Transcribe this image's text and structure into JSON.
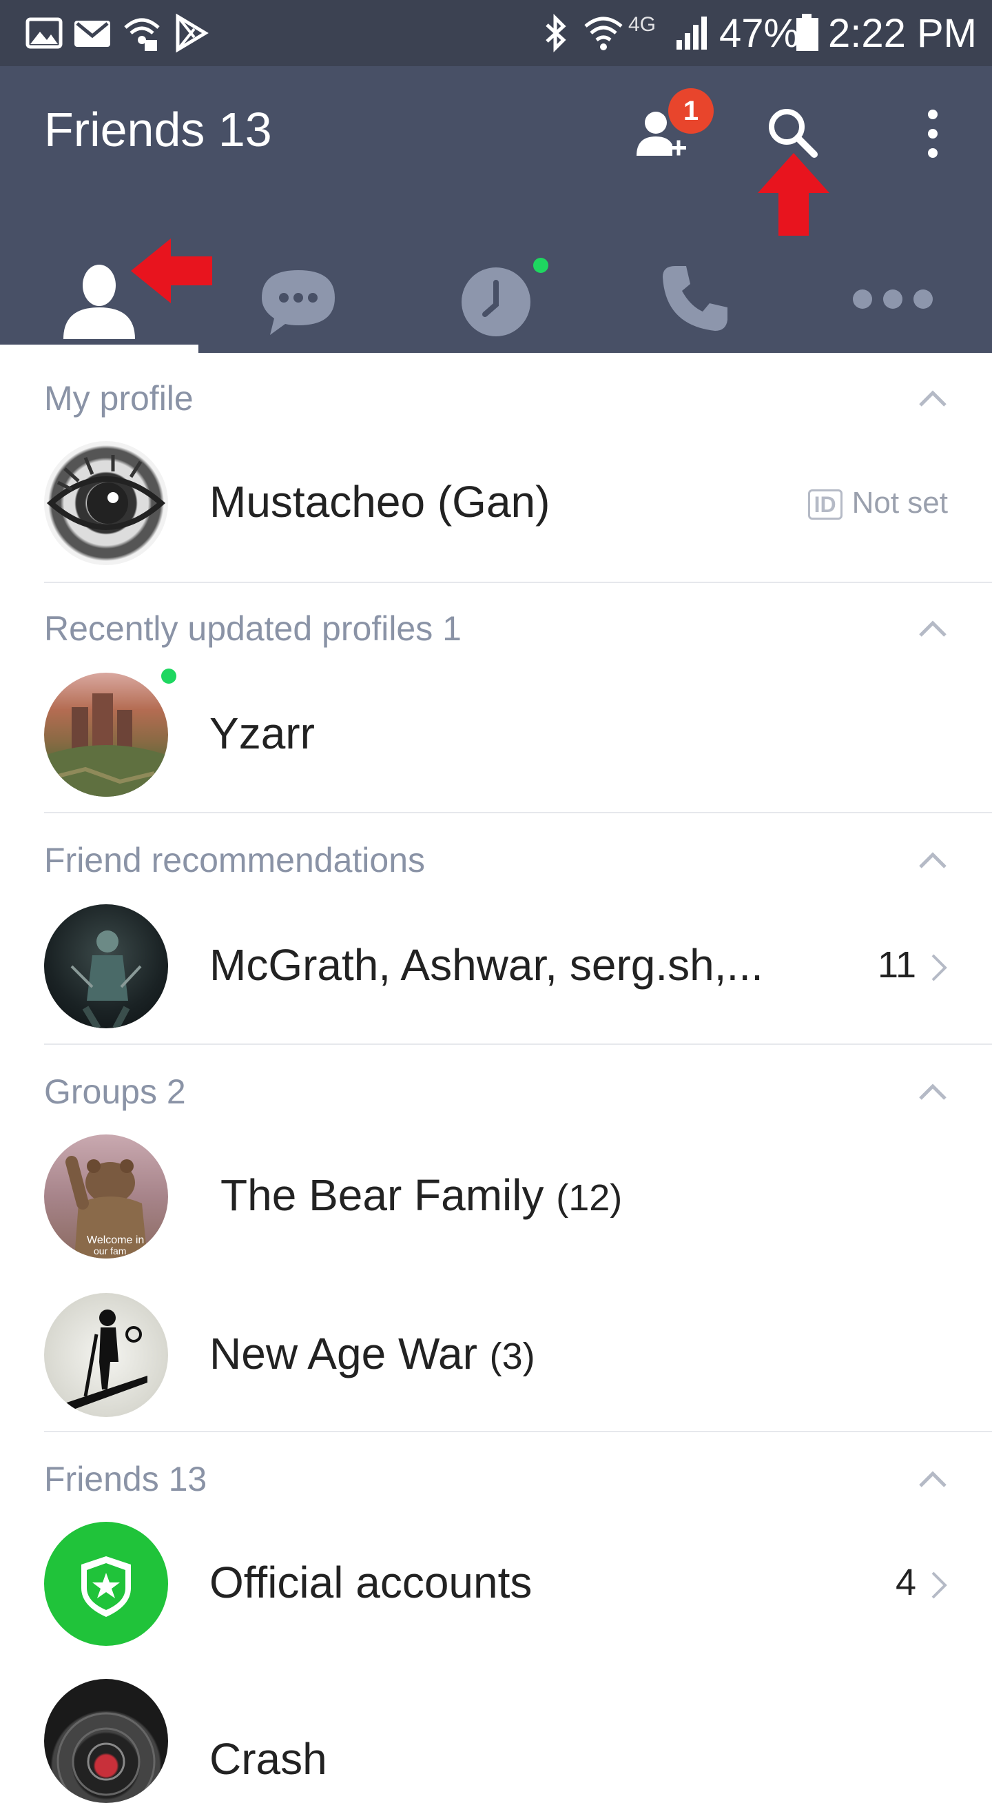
{
  "status_bar": {
    "network": "4G",
    "battery": "47%",
    "time": "2:22 PM"
  },
  "header": {
    "title": "Friends 13",
    "add_friend_badge": "1",
    "icons": [
      "add-friend-icon",
      "search-icon",
      "more-vert-icon"
    ]
  },
  "tabs": [
    {
      "name": "friends",
      "icon": "person-icon",
      "selected": true
    },
    {
      "name": "chats",
      "icon": "chat-bubble-icon",
      "selected": false
    },
    {
      "name": "timeline",
      "icon": "clock-icon",
      "selected": false,
      "new_dot": true
    },
    {
      "name": "calls",
      "icon": "phone-icon",
      "selected": false
    },
    {
      "name": "more",
      "icon": "more-horiz-icon",
      "selected": false
    }
  ],
  "colors": {
    "header_bg": "#485066",
    "status_bg": "#3c4252",
    "badge": "#e8452c",
    "online": "#1ed760",
    "annotation_arrow": "#e8141e",
    "official_green": "#20c33a"
  },
  "sections": {
    "my_profile": {
      "title": "My profile",
      "name": "Mustacheo (Gan)",
      "id_badge": "ID",
      "id_status": "Not set"
    },
    "recently_updated": {
      "title": "Recently updated profiles 1",
      "name": "Yzarr"
    },
    "recommendations": {
      "title": "Friend recommendations",
      "name": "McGrath, Ashwar, serg.sh,...",
      "count": "11"
    },
    "groups": {
      "title": "Groups 2",
      "items": [
        {
          "name": "The Bear Family",
          "count": "(12)",
          "avatar_caption_1": "Welcome in",
          "avatar_caption_2": "our fam"
        },
        {
          "name": "New Age War",
          "count": "(3)"
        }
      ]
    },
    "friends": {
      "title": "Friends 13",
      "items": [
        {
          "name": "Official accounts",
          "count": "4"
        },
        {
          "name": "Crash"
        }
      ]
    }
  }
}
